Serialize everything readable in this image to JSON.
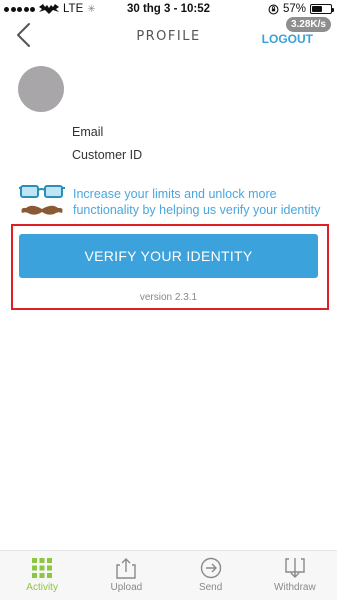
{
  "status_bar": {
    "carrier": "LTE",
    "time": "30 thg 3 - 10:52",
    "battery": "57%",
    "battery_level": 0.57,
    "speed_badge": "3.28K/s"
  },
  "header": {
    "title": "PROFILE",
    "logout_label": "LOGOUT"
  },
  "profile": {
    "email_label": "Email",
    "customer_id_label": "Customer ID"
  },
  "promo": {
    "text": "Increase your limits and unlock more functionality by helping us verify your identity",
    "icon": "glasses-mustache-icon"
  },
  "verify": {
    "button_label": "VERIFY YOUR IDENTITY",
    "version": "version 2.3.1"
  },
  "tabs": [
    {
      "label": "Activity",
      "icon": "grid-icon",
      "active": true
    },
    {
      "label": "Upload",
      "icon": "upload-icon",
      "active": false
    },
    {
      "label": "Send",
      "icon": "send-icon",
      "active": false
    },
    {
      "label": "Withdraw",
      "icon": "withdraw-icon",
      "active": false
    }
  ],
  "colors": {
    "accent": "#3ba2dc",
    "active_tab": "#8dc63f",
    "highlight": "#dd1f26"
  }
}
